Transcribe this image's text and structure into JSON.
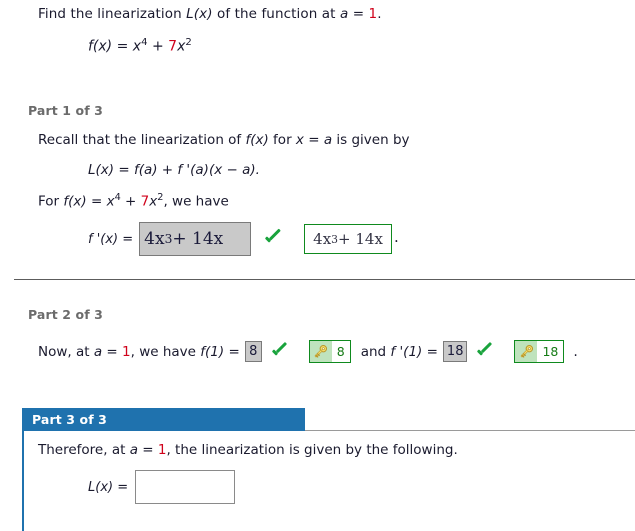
{
  "problem": {
    "prompt_pre": "Find the linearization ",
    "prompt_Lx": "L(x)",
    "prompt_mid": " of the function at ",
    "prompt_a": "a",
    "prompt_eq": " = ",
    "prompt_value": "1",
    "prompt_end": ".",
    "function_label": "f(x)",
    "function_eq": " = ",
    "function_x": "x",
    "function_exp1": "4",
    "function_plus": " + ",
    "function_coef": "7",
    "function_x2": "x",
    "function_exp2": "2"
  },
  "part1": {
    "heading": "Part 1 of 3",
    "line1_pre": "Recall that the linearization of ",
    "line1_fx": "f(x)",
    "line1_mid": " for ",
    "line1_x": "x",
    "line1_eq": " = ",
    "line1_a": "a",
    "line1_end": " is given by",
    "formula": "L(x) = f(a) + f '(a)(x − a).",
    "line3_pre": "For ",
    "line3_fx": "f(x)",
    "line3_eq": " = ",
    "line3_x": "x",
    "line3_exp1": "4",
    "line3_plus": " + ",
    "line3_coef": "7",
    "line3_x2": "x",
    "line3_exp2": "2",
    "line3_end": ",  we have",
    "answer_label": "f '(x) = ",
    "answer_value_x": "4x",
    "answer_value_exp": "3",
    "answer_value_rest": " + 14x",
    "status_icon": "green-check-icon",
    "correct_answer_x": "4x",
    "correct_answer_exp": "3",
    "correct_answer_rest": " + 14x",
    "trailing_period": "."
  },
  "part2": {
    "heading": "Part 2 of 3",
    "text_pre": "Now, at ",
    "text_a": "a",
    "text_eq": " = ",
    "text_value": "1",
    "text_mid": ",  we have ",
    "f_label": "f(1)",
    "f_eq": " = ",
    "f_answer": "8",
    "f_status_icon": "green-check-icon",
    "f_key_icon": "key-icon",
    "f_key_value": "8",
    "conj": "  and  ",
    "fp_label": "f '(1)",
    "fp_eq": " = ",
    "fp_answer": "18",
    "fp_status_icon": "green-check-icon",
    "fp_key_icon": "key-icon",
    "fp_key_value": "18",
    "trailing_period": "."
  },
  "part3": {
    "heading": "Part 3 of 3",
    "text_pre": "Therefore, at ",
    "text_a": "a",
    "text_eq": " = ",
    "text_value": "1",
    "text_end": ",  the linearization is given by the following.",
    "answer_label": "L(x) =",
    "answer_value": "",
    "answer_placeholder": ""
  },
  "colors": {
    "accent_blue": "#1f72ae",
    "highlight_red": "#d0021b",
    "correct_green": "#0f8a1e",
    "check_green": "#19a33c",
    "filled_box_gray": "#c9c9c9",
    "key_bg_green": "#bfe3bd"
  }
}
